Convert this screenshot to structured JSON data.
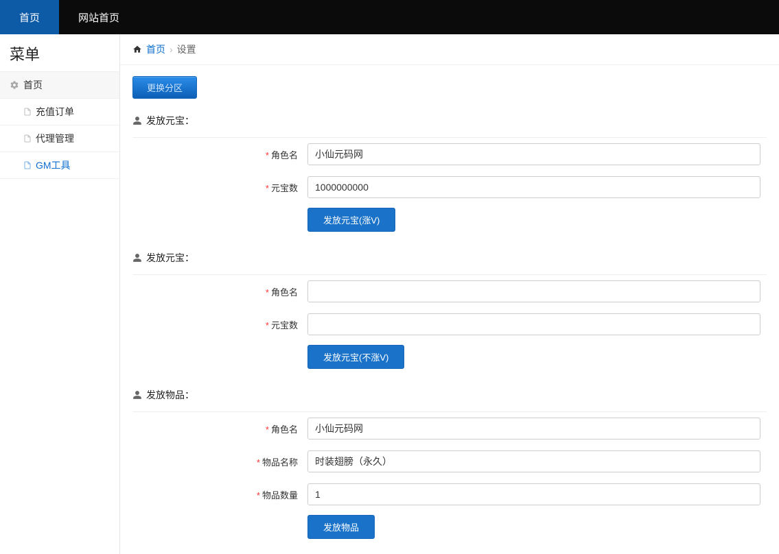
{
  "navbar": {
    "tab1": "首页",
    "tab2": "网站首页"
  },
  "sidebar": {
    "title": "菜单",
    "parent": "首页",
    "item1": "充值订单",
    "item2": "代理管理",
    "item3": "GM工具"
  },
  "breadcrumb": {
    "home": "首页",
    "current": "设置"
  },
  "top_button": "更换分区",
  "section1": {
    "title": "发放元宝：",
    "label_role": "角色名",
    "label_amount": "元宝数",
    "value_role": "小仙元码网",
    "value_amount": "1000000000",
    "button": "发放元宝(涨V)"
  },
  "section2": {
    "title": "发放元宝：",
    "label_role": "角色名",
    "label_amount": "元宝数",
    "value_role": "",
    "value_amount": "",
    "button": "发放元宝(不涨V)"
  },
  "section3": {
    "title": "发放物品：",
    "label_role": "角色名",
    "label_item": "物品名称",
    "label_qty": "物品数量",
    "value_role": "小仙元码网",
    "value_item": "时装翅膀（永久）",
    "value_qty": "1",
    "button": "发放物品"
  }
}
